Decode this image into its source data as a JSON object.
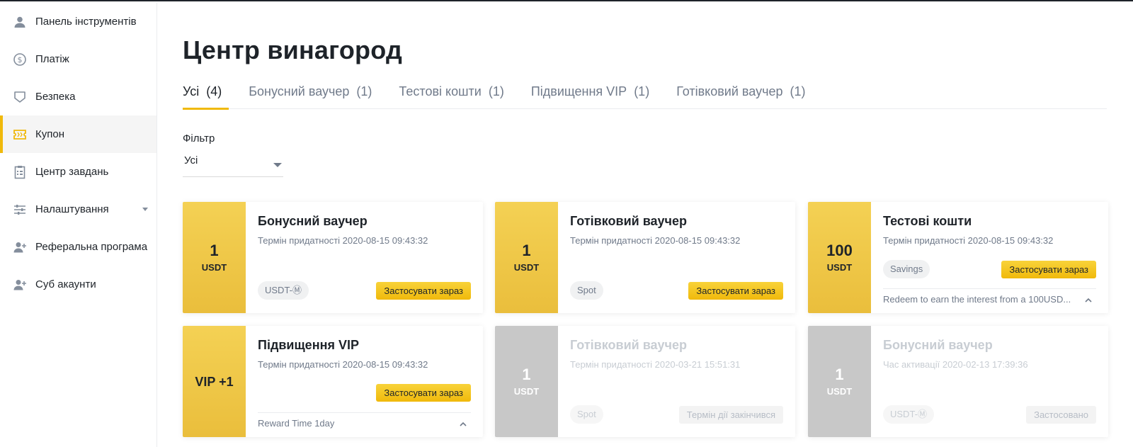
{
  "sidebar": {
    "items": [
      {
        "label": "Панель інструментів",
        "icon": "user-icon"
      },
      {
        "label": "Платіж",
        "icon": "dollar-circle-icon"
      },
      {
        "label": "Безпека",
        "icon": "shield-icon"
      },
      {
        "label": "Купон",
        "icon": "ticket-icon",
        "active": true
      },
      {
        "label": "Центр завдань",
        "icon": "clipboard-icon"
      },
      {
        "label": "Налаштування",
        "icon": "sliders-icon",
        "has_submenu": true
      },
      {
        "label": "Реферальна програма",
        "icon": "user-plus-icon"
      },
      {
        "label": "Суб акаунти",
        "icon": "user-plus-icon"
      }
    ]
  },
  "main": {
    "title": "Центр винагород",
    "tabs": [
      {
        "label": "Усі",
        "count": "(4)",
        "active": true
      },
      {
        "label": "Бонусний ваучер",
        "count": "(1)"
      },
      {
        "label": "Тестові кошти",
        "count": "(1)"
      },
      {
        "label": "Підвищення VIP",
        "count": "(1)"
      },
      {
        "label": "Готівковий ваучер",
        "count": "(1)"
      }
    ],
    "filter": {
      "label": "Фільтр",
      "value": "Усі"
    }
  },
  "cards": [
    {
      "amount": "1",
      "unit": "USDT",
      "title": "Бонусний ваучер",
      "date": "Термін придатності 2020-08-15 09:43:32",
      "tag": "USDT-Ⓜ",
      "button": "Застосувати зараз"
    },
    {
      "amount": "1",
      "unit": "USDT",
      "title": "Готівковий ваучер",
      "date": "Термін придатності 2020-08-15 09:43:32",
      "tag": "Spot",
      "button": "Застосувати зараз"
    },
    {
      "amount": "100",
      "unit": "USDT",
      "title": "Тестові кошти",
      "date": "Термін придатності 2020-08-15 09:43:32",
      "tag": "Savings",
      "button": "Застосувати зараз",
      "description": "Redeem to earn the interest from a 100USD..."
    },
    {
      "amount": "VIP +1",
      "title": "Підвищення VIP",
      "date": "Термін придатності 2020-08-15 09:43:32",
      "button": "Застосувати зараз",
      "description": "Reward Time 1day"
    },
    {
      "amount": "1",
      "unit": "USDT",
      "title": "Готівковий ваучер",
      "date": "Термін придатності 2020-03-21 15:51:31",
      "tag": "Spot",
      "status": "Термін дії закінчився"
    },
    {
      "amount": "1",
      "unit": "USDT",
      "title": "Бонусний ваучер",
      "date": "Час активації 2020-02-13 17:39:36",
      "tag": "USDT-Ⓜ",
      "status": "Застосовано"
    }
  ],
  "colors": {
    "accent": "#f0b90b",
    "text": "#1e2329",
    "muted": "#707a8a",
    "disabled": "#c8c8c8"
  }
}
